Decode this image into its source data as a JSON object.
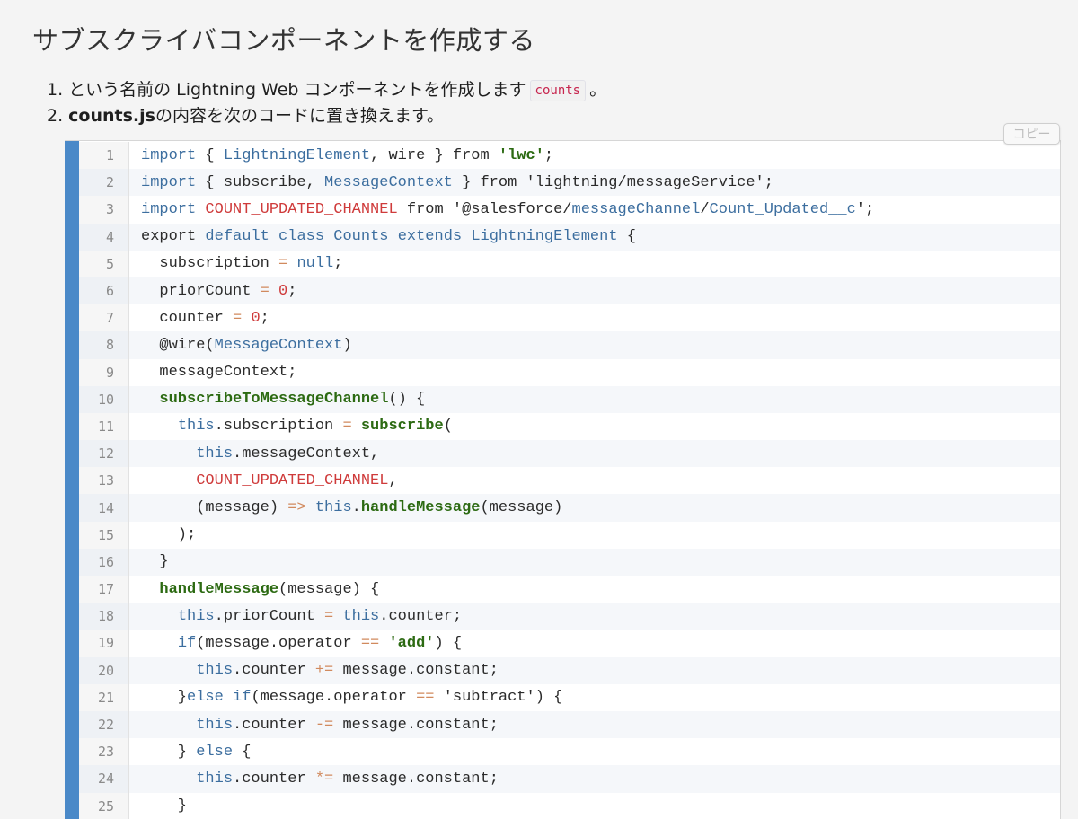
{
  "title": "サブスクライバコンポーネントを作成する",
  "steps": [
    {
      "num": "1.",
      "before": "という名前の Lightning Web コンポーネントを作成します",
      "code": "counts",
      "after": "。"
    },
    {
      "num": "2.",
      "bold": "counts.js",
      "after": "の内容を次のコードに置き換えます。"
    }
  ],
  "copy_label": "コピー",
  "code_lines": [
    [
      [
        "kw",
        "import"
      ],
      [
        "pl",
        " { "
      ],
      [
        "kw",
        "LightningElement"
      ],
      [
        "pl",
        ", wire } from "
      ],
      [
        "strb",
        "'lwc'"
      ],
      [
        "pl",
        ";"
      ]
    ],
    [
      [
        "kw",
        "import"
      ],
      [
        "pl",
        " { subscribe, "
      ],
      [
        "kw",
        "MessageContext"
      ],
      [
        "pl",
        " } from 'lightning/messageService';"
      ]
    ],
    [
      [
        "kw",
        "import"
      ],
      [
        "pl",
        " "
      ],
      [
        "const",
        "COUNT_UPDATED_CHANNEL"
      ],
      [
        "pl",
        " from '@salesforce/"
      ],
      [
        "kw",
        "messageChannel"
      ],
      [
        "pl",
        "/"
      ],
      [
        "kw",
        "Count_Updated__c"
      ],
      [
        "pl",
        "';"
      ]
    ],
    [
      [
        "pl",
        "export "
      ],
      [
        "kw",
        "default"
      ],
      [
        "pl",
        " "
      ],
      [
        "kw",
        "class"
      ],
      [
        "pl",
        " "
      ],
      [
        "kw",
        "Counts"
      ],
      [
        "pl",
        " "
      ],
      [
        "kw",
        "extends"
      ],
      [
        "pl",
        " "
      ],
      [
        "kw",
        "LightningElement"
      ],
      [
        "pl",
        " {"
      ]
    ],
    [
      [
        "pl",
        "  subscription "
      ],
      [
        "op",
        "="
      ],
      [
        "pl",
        " "
      ],
      [
        "kw",
        "null"
      ],
      [
        "pl",
        ";"
      ]
    ],
    [
      [
        "pl",
        "  priorCount "
      ],
      [
        "op",
        "="
      ],
      [
        "pl",
        " "
      ],
      [
        "num",
        "0"
      ],
      [
        "pl",
        ";"
      ]
    ],
    [
      [
        "pl",
        "  counter "
      ],
      [
        "op",
        "="
      ],
      [
        "pl",
        " "
      ],
      [
        "num",
        "0"
      ],
      [
        "pl",
        ";"
      ]
    ],
    [
      [
        "pl",
        "  @wire("
      ],
      [
        "kw",
        "MessageContext"
      ],
      [
        "pl",
        ")"
      ]
    ],
    [
      [
        "pl",
        "  messageContext;"
      ]
    ],
    [
      [
        "pl",
        "  "
      ],
      [
        "fn",
        "subscribeToMessageChannel"
      ],
      [
        "pl",
        "() {"
      ]
    ],
    [
      [
        "pl",
        "    "
      ],
      [
        "kw",
        "this"
      ],
      [
        "pl",
        ".subscription "
      ],
      [
        "op",
        "="
      ],
      [
        "pl",
        " "
      ],
      [
        "fn",
        "subscribe"
      ],
      [
        "pl",
        "("
      ]
    ],
    [
      [
        "pl",
        "      "
      ],
      [
        "kw",
        "this"
      ],
      [
        "pl",
        ".messageContext,"
      ]
    ],
    [
      [
        "pl",
        "      "
      ],
      [
        "const",
        "COUNT_UPDATED_CHANNEL"
      ],
      [
        "pl",
        ","
      ]
    ],
    [
      [
        "pl",
        "      (message) "
      ],
      [
        "op",
        "=>"
      ],
      [
        "pl",
        " "
      ],
      [
        "kw",
        "this"
      ],
      [
        "pl",
        "."
      ],
      [
        "fn",
        "handleMessage"
      ],
      [
        "pl",
        "(message)"
      ]
    ],
    [
      [
        "pl",
        "    );"
      ]
    ],
    [
      [
        "pl",
        "  }"
      ]
    ],
    [
      [
        "pl",
        "  "
      ],
      [
        "fn",
        "handleMessage"
      ],
      [
        "pl",
        "(message) {"
      ]
    ],
    [
      [
        "pl",
        "    "
      ],
      [
        "kw",
        "this"
      ],
      [
        "pl",
        ".priorCount "
      ],
      [
        "op",
        "="
      ],
      [
        "pl",
        " "
      ],
      [
        "kw",
        "this"
      ],
      [
        "pl",
        ".counter;"
      ]
    ],
    [
      [
        "pl",
        "    "
      ],
      [
        "kw",
        "if"
      ],
      [
        "pl",
        "(message.operator "
      ],
      [
        "op",
        "=="
      ],
      [
        "pl",
        " "
      ],
      [
        "strb",
        "'add'"
      ],
      [
        "pl",
        ") {"
      ]
    ],
    [
      [
        "pl",
        "      "
      ],
      [
        "kw",
        "this"
      ],
      [
        "pl",
        ".counter "
      ],
      [
        "op",
        "+="
      ],
      [
        "pl",
        " message.constant;"
      ]
    ],
    [
      [
        "pl",
        "    }"
      ],
      [
        "kw",
        "else"
      ],
      [
        "pl",
        " "
      ],
      [
        "kw",
        "if"
      ],
      [
        "pl",
        "(message.operator "
      ],
      [
        "op",
        "=="
      ],
      [
        "pl",
        " 'subtract') {"
      ]
    ],
    [
      [
        "pl",
        "      "
      ],
      [
        "kw",
        "this"
      ],
      [
        "pl",
        ".counter "
      ],
      [
        "op",
        "-="
      ],
      [
        "pl",
        " message.constant;"
      ]
    ],
    [
      [
        "pl",
        "    } "
      ],
      [
        "kw",
        "else"
      ],
      [
        "pl",
        " {"
      ]
    ],
    [
      [
        "pl",
        "      "
      ],
      [
        "kw",
        "this"
      ],
      [
        "pl",
        ".counter "
      ],
      [
        "op",
        "*="
      ],
      [
        "pl",
        " message.constant;"
      ]
    ],
    [
      [
        "pl",
        "    }"
      ]
    ]
  ],
  "colors": {
    "accent_bar": "#4a89c8",
    "keyword": "#3c6e9f",
    "constant": "#cf3b3b",
    "function": "#2c6a12",
    "operator": "#d18a5e",
    "inline_code": "#c7254e"
  }
}
